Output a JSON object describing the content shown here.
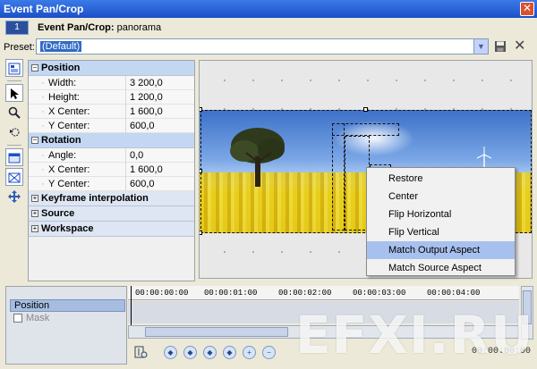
{
  "window": {
    "title": "Event Pan/Crop",
    "close_glyph": "✕"
  },
  "header": {
    "track_number": "1",
    "label": "Event Pan/Crop:",
    "event_name": "panorama"
  },
  "preset": {
    "label": "Preset:",
    "value": "(Default)",
    "save_icon": "save-icon",
    "delete_icon": "delete-icon",
    "delete_glyph": "✕"
  },
  "toolbar": {
    "icons": [
      "show-properties-icon",
      "normal-edit-tool-icon",
      "zoom-tool-icon",
      "enable-rotation-icon",
      "snap-to-grid-icon",
      "lock-aspect-ratio-icon",
      "move-freely-icon"
    ]
  },
  "properties": {
    "sections": [
      {
        "label": "Position",
        "expanded": true,
        "rows": [
          {
            "name": "Width:",
            "value": "3 200,0"
          },
          {
            "name": "Height:",
            "value": "1 200,0"
          },
          {
            "name": "X Center:",
            "value": "1 600,0"
          },
          {
            "name": "Y Center:",
            "value": "600,0"
          }
        ]
      },
      {
        "label": "Rotation",
        "expanded": true,
        "rows": [
          {
            "name": "Angle:",
            "value": "0,0"
          },
          {
            "name": "X Center:",
            "value": "1 600,0"
          },
          {
            "name": "Y Center:",
            "value": "600,0"
          }
        ]
      },
      {
        "label": "Keyframe interpolation",
        "expanded": false
      },
      {
        "label": "Source",
        "expanded": false
      },
      {
        "label": "Workspace",
        "expanded": false
      }
    ]
  },
  "context_menu": {
    "items": [
      {
        "label": "Restore"
      },
      {
        "label": "Center"
      },
      {
        "label": "Flip Horizontal"
      },
      {
        "label": "Flip Vertical"
      },
      {
        "label": "Match Output Aspect",
        "highlighted": true
      },
      {
        "label": "Match Source Aspect"
      }
    ]
  },
  "timeline": {
    "tracks": [
      "Position",
      "Mask"
    ],
    "ruler": [
      "00:00:00:00",
      "00:00:01:00",
      "00:00:02:00",
      "00:00:03:00",
      "00:00:04:00"
    ],
    "current_time": "00:00:00:00"
  },
  "watermark": "EFXI.RU",
  "colors": {
    "title_bar": "#1c4fc7",
    "selection": "#316ac5",
    "menu_highlight": "#a8c0ee"
  }
}
